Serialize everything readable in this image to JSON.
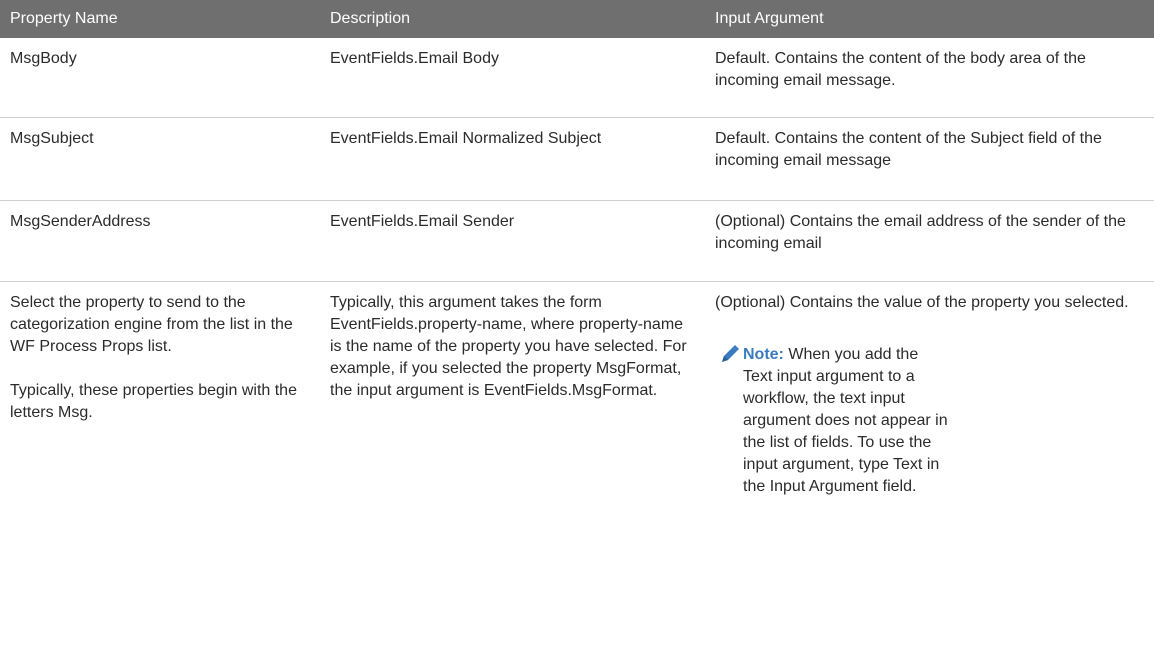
{
  "table": {
    "headers": [
      "Property Name",
      "Description",
      "Input Argument"
    ],
    "rows": [
      {
        "property": "MsgBody",
        "description": "EventFields.Email Body",
        "input": "Default. Contains the content of the body area of the incoming email message."
      },
      {
        "property": "MsgSubject",
        "description": "EventFields.Email Normalized Subject",
        "input": "Default. Contains the content of the Subject field of the incoming email message"
      },
      {
        "property": "MsgSenderAddress",
        "description": "EventFields.Email Sender",
        "input": "(Optional) Contains the email address of the sender of the incoming email"
      },
      {
        "property_p1": "Select the property to send to the categorization engine from the list in the WF Process Props list.",
        "property_p2": "Typically, these properties begin with the letters Msg.",
        "description": "Typically, this argument takes the form EventFields.property-name, where property-name is the name of the property you have selected. For example, if you selected the property MsgFormat, the input argument is EventFields.MsgFormat.",
        "input": "(Optional) Contains the value of the property you selected.",
        "note_label": "Note:",
        "note_text": "When you add the Text input argument to a workflow, the text input argument does not appear in the list of fields. To use the input argument, type Text in the Input Argument field."
      }
    ]
  },
  "colors": {
    "header_bg": "#6f6f6f",
    "header_text": "#ffffff",
    "note_accent": "#3a7bbf",
    "divider": "#cfcfcf"
  },
  "icons": {
    "note": "pencil-icon"
  }
}
